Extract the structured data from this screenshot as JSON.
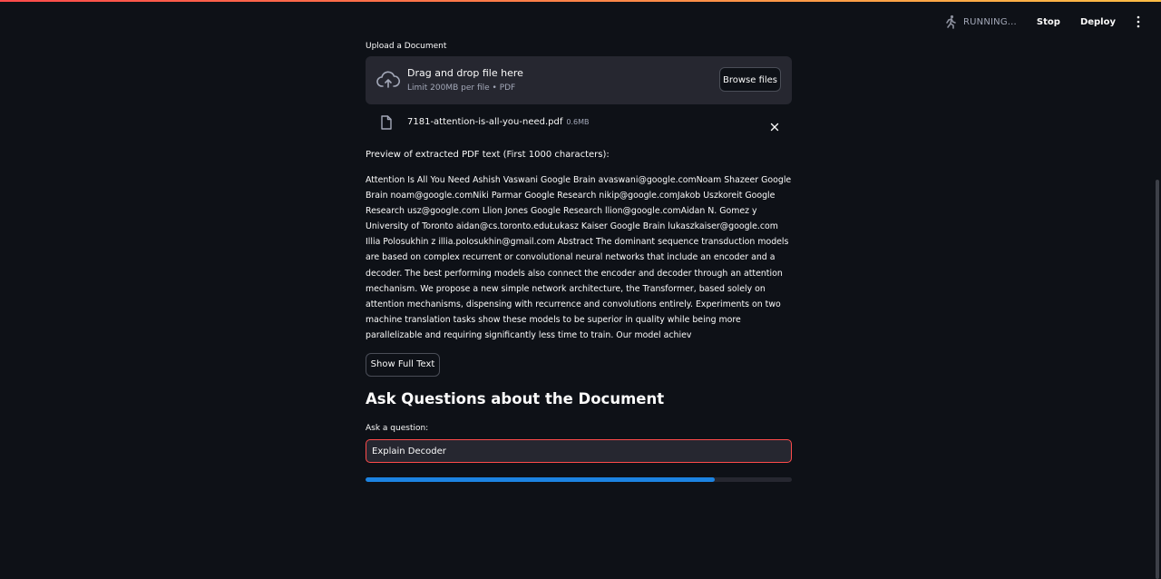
{
  "header": {
    "status_text": "RUNNING...",
    "stop_label": "Stop",
    "deploy_label": "Deploy",
    "running_icon": "running-person-icon",
    "menu_icon": "kebab-menu-icon"
  },
  "uploader": {
    "label": "Upload a Document",
    "drop_title": "Drag and drop file here",
    "drop_limit": "Limit 200MB per file • PDF",
    "browse_label": "Browse files",
    "icon": "cloud-upload-icon"
  },
  "file": {
    "name": "7181-attention-is-all-you-need.pdf",
    "size": "0.6MB",
    "icon": "file-icon",
    "remove_icon": "close-icon"
  },
  "preview": {
    "title": "Preview of extracted PDF text (First 1000 characters):",
    "text": "Attention Is All You Need Ashish Vaswani  Google Brain avaswani@google.comNoam Shazeer  Google Brain noam@google.comNiki Parmar  Google Research nikip@google.comJakob Uszkoreit  Google Research usz@google.com Llion Jones  Google Research llion@google.comAidan N. Gomez  y University of Toronto aidan@cs.toronto.eduŁukasz Kaiser  Google Brain lukaszkaiser@google.com Illia Polosukhin  z illia.polosukhin@gmail.com Abstract The dominant sequence transduction models are based on complex recurrent or convolutional neural networks that include an encoder and a decoder. The best performing models also connect the encoder and decoder through an attention mechanism. We propose a new simple network architecture, the Transformer, based solely on attention mechanisms, dispensing with recurrence and convolutions entirely. Experiments on two machine translation tasks show these models to be superior in quality while being more parallelizable and requiring significantly less time to train. Our model achiev",
    "show_full_label": "Show Full Text"
  },
  "qa": {
    "heading": "Ask Questions about the Document",
    "label": "Ask a question:",
    "value": "Explain Decoder",
    "progress_fraction": 0.82
  },
  "colors": {
    "background": "#0e1117",
    "panel": "#262730",
    "accent": "#ff4b4b",
    "progress": "#1c83e1"
  }
}
